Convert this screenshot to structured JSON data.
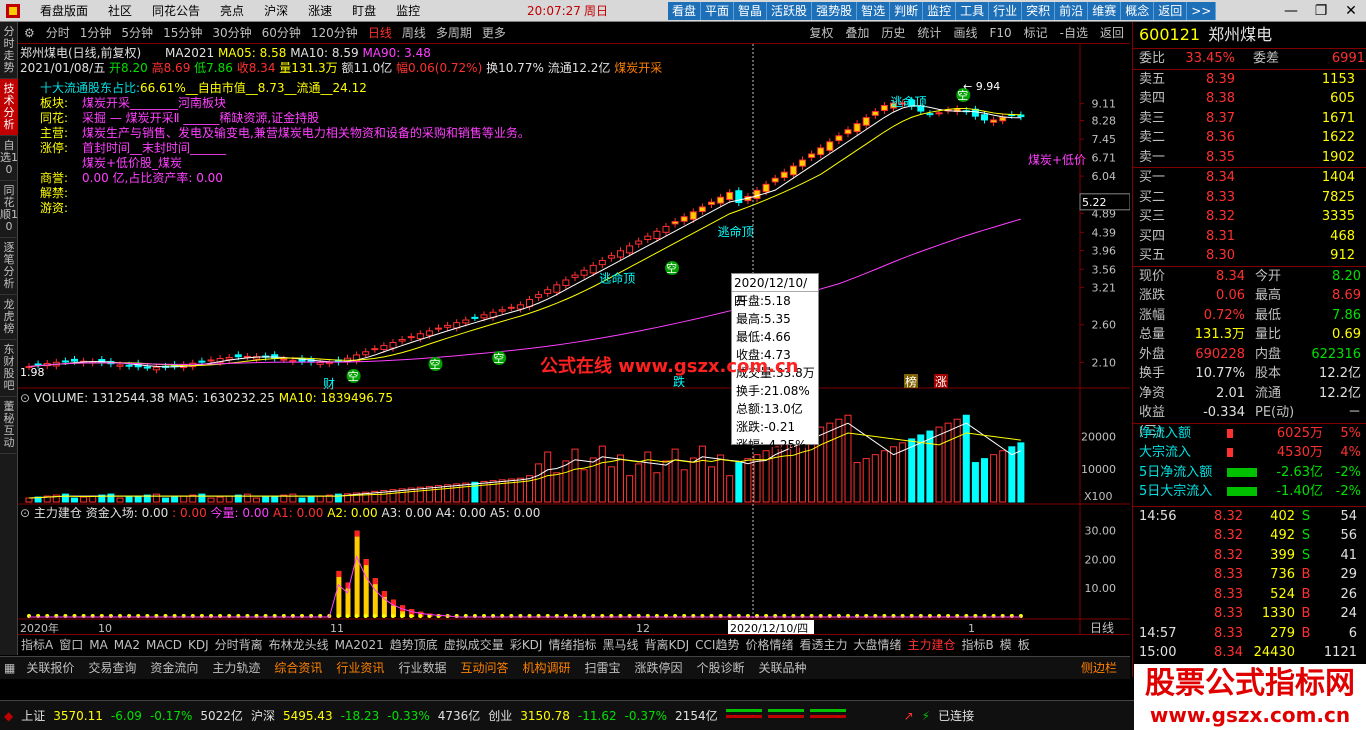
{
  "menu": {
    "items": [
      "看盘版面",
      "社区",
      "同花公告",
      "亮点",
      "沪深",
      "涨速",
      "盯盘",
      "监控"
    ],
    "time": "20:07:27",
    "weekday": "周日",
    "quick": [
      "看盘",
      "平面",
      "智晶",
      "活跃股",
      "强势股",
      "智选",
      "判断",
      "监控",
      "工具",
      "行业",
      "突积",
      "前沿",
      "维赛",
      "概念",
      "返回",
      ">>"
    ]
  },
  "vtabs": [
    "分时走势",
    "技术分析",
    "自选10",
    "同花顺10",
    "逐笔分析",
    "龙虎榜",
    "东财股吧",
    "董秘互动"
  ],
  "periods": [
    "分时",
    "1分钟",
    "5分钟",
    "15分钟",
    "30分钟",
    "60分钟",
    "120分钟",
    "日线",
    "周线",
    "多周期",
    "更多"
  ],
  "period_active": "日线",
  "toolbar": [
    "复权",
    "叠加",
    "历史",
    "统计",
    "画线",
    "F10",
    "标记",
    "-自选",
    "返回"
  ],
  "chart": {
    "title": "郑州煤电(日线,前复权)",
    "ma_label": "MA2021",
    "ma05": "MA05: 8.58",
    "ma10": "MA10: 8.59",
    "ma90": "MA90: 3.48",
    "date": "2021/01/08/五",
    "open": "开8.20",
    "high": "高8.69",
    "low": "低7.86",
    "close": "收8.34",
    "vol": "量131.3万",
    "amt": "额11.0亿",
    "chg": "幅0.06(0.72%)",
    "turn": "换10.77%",
    "float": "流通12.2亿",
    "concept": "煤炭开采",
    "info_lines": [
      {
        "label": "十大流通股东占比:",
        "value": "66.61%__自由市值__8.73__流通__24.12"
      },
      {
        "label": "板块:",
        "value": "煤炭开采________河南板块"
      },
      {
        "label": "同花:",
        "value": "采掘 — 煤炭开采Ⅱ ______稀缺资源,证金持股"
      },
      {
        "label": "主营:",
        "value": "煤炭生产与销售、发电及输变电,兼营煤炭电力相关物资和设备的采购和销售等业务。"
      },
      {
        "label": "涨停:",
        "value": "首封时间__末封时间______"
      },
      {
        "label": "",
        "value": "煤炭+低价股_煤炭"
      },
      {
        "label": "商誉:",
        "value": "0.00 亿,占比资产率: 0.00"
      },
      {
        "label": "解禁:",
        "value": ""
      },
      {
        "label": "游资:",
        "value": ""
      }
    ],
    "y_ticks": [
      "9.11",
      "8.28",
      "7.45",
      "6.71",
      "6.04",
      "4.89",
      "4.39",
      "3.96",
      "3.56",
      "3.21",
      "2.60",
      "2.10"
    ],
    "cursor_price": "5.22",
    "peak_label": "9.94",
    "low_label": "1.98",
    "labels": {
      "escape": "逃命顶",
      "air": "空",
      "wealth": "财",
      "fall": "跌",
      "rank": "榜",
      "rise": "涨",
      "concept_tag": "煤炭+低价"
    },
    "x_ticks": [
      "2020年",
      "10",
      "11",
      "12",
      "2020/12/10/四",
      "1"
    ],
    "x_right": "日线"
  },
  "volume": {
    "label": "VOLUME: 1312544.38",
    "ma5": "MA5: 1630232.25",
    "ma10": "MA10: 1839496.75",
    "y_ticks": [
      "20000",
      "10000"
    ],
    "unit": "X100"
  },
  "indicator": {
    "label": "主力建仓",
    "v1": "资金入场: 0.00",
    "v2": ": 0.00",
    "v3": "今量: 0.00",
    "a1": "A1: 0.00",
    "a2": "A2: 0.00",
    "a3": "A3: 0.00",
    "a4": "A4: 0.00",
    "a5": "A5: 0.00",
    "y_ticks": [
      "30.00",
      "20.00",
      "10.00"
    ]
  },
  "tooltip": {
    "date": "2020/12/10/四",
    "lines": [
      "开盘:5.18",
      "最高:5.35",
      "最低:4.66",
      "收盘:4.73",
      "成交量:33.8万",
      "换手:21.08%",
      "总额:13.0亿",
      "涨跌:-0.21",
      "涨幅:-4.25%"
    ]
  },
  "watermark": "公式在线 www.gszx.com.cn",
  "indicator_tabs": [
    "指标A",
    "窗口",
    "MA",
    "MA2",
    "MACD",
    "KDJ",
    "分时背离",
    "布林龙头线",
    "MA2021",
    "趋势顶底",
    "虚拟成交量",
    "彩KDJ",
    "情绪指标",
    "黑马线",
    "背离KDJ",
    "CCI趋势",
    "价格情绪",
    "看透主力",
    "大盘情绪",
    "主力建仓",
    "指标B",
    "模",
    "板"
  ],
  "indicator_active": "主力建仓",
  "bottom_tabs": [
    {
      "t": "关联报价",
      "hl": false
    },
    {
      "t": "交易查询",
      "hl": false
    },
    {
      "t": "资金流向",
      "hl": false
    },
    {
      "t": "主力轨迹",
      "hl": false
    },
    {
      "t": "综合资讯",
      "hl": true
    },
    {
      "t": "行业资讯",
      "hl": true
    },
    {
      "t": "行业数据",
      "hl": false
    },
    {
      "t": "互动问答",
      "hl": true
    },
    {
      "t": "机构调研",
      "hl": true
    },
    {
      "t": "扫雷宝",
      "hl": false
    },
    {
      "t": "涨跌停因",
      "hl": false
    },
    {
      "t": "个股诊断",
      "hl": false
    },
    {
      "t": "关联品种",
      "hl": false
    }
  ],
  "side_label": "侧边栏",
  "status": {
    "sh_name": "上证",
    "sh_val": "3570.11",
    "sh_chg": "-6.09",
    "sh_pct": "-0.17%",
    "sh_amt": "5022亿",
    "sz_name": "沪深",
    "sz_val": "5495.43",
    "sz_chg": "-18.23",
    "sz_pct": "-0.33%",
    "sz_amt": "4736亿",
    "cy_name": "创业",
    "cy_val": "3150.78",
    "cy_chg": "-11.62",
    "cy_pct": "-0.37%",
    "cy_amt": "2154亿",
    "conn": "已连接"
  },
  "quote": {
    "code": "600121",
    "name": "郑州煤电",
    "ratio_label": "委比",
    "ratio": "33.45%",
    "diff_label": "委差",
    "diff": "6991",
    "asks": [
      {
        "l": "卖五",
        "p": "8.39",
        "v": "1153"
      },
      {
        "l": "卖四",
        "p": "8.38",
        "v": "605"
      },
      {
        "l": "卖三",
        "p": "8.37",
        "v": "1671"
      },
      {
        "l": "卖二",
        "p": "8.36",
        "v": "1622"
      },
      {
        "l": "卖一",
        "p": "8.35",
        "v": "1902"
      }
    ],
    "bids": [
      {
        "l": "买一",
        "p": "8.34",
        "v": "1404"
      },
      {
        "l": "买二",
        "p": "8.33",
        "v": "7825"
      },
      {
        "l": "买三",
        "p": "8.32",
        "v": "3335"
      },
      {
        "l": "买四",
        "p": "8.31",
        "v": "468"
      },
      {
        "l": "买五",
        "p": "8.30",
        "v": "912"
      }
    ],
    "stats": [
      {
        "l1": "现价",
        "v1": "8.34",
        "c1": "red",
        "l2": "今开",
        "v2": "8.20",
        "c2": "grn"
      },
      {
        "l1": "涨跌",
        "v1": "0.06",
        "c1": "red",
        "l2": "最高",
        "v2": "8.69",
        "c2": "red"
      },
      {
        "l1": "涨幅",
        "v1": "0.72%",
        "c1": "red",
        "l2": "最低",
        "v2": "7.86",
        "c2": "grn"
      },
      {
        "l1": "总量",
        "v1": "131.3万",
        "c1": "yel",
        "l2": "量比",
        "v2": "0.69",
        "c2": "yel"
      },
      {
        "l1": "外盘",
        "v1": "690228",
        "c1": "red",
        "l2": "内盘",
        "v2": "622316",
        "c2": "grn"
      },
      {
        "l1": "换手",
        "v1": "10.77%",
        "c1": "wht",
        "l2": "股本",
        "v2": "12.2亿",
        "c2": "wht"
      },
      {
        "l1": "净资",
        "v1": "2.01",
        "c1": "wht",
        "l2": "流通",
        "v2": "12.2亿",
        "c2": "wht"
      },
      {
        "l1": "收益(三)",
        "v1": "-0.334",
        "c1": "wht",
        "l2": "PE(动)",
        "v2": "－",
        "c2": "wht"
      }
    ],
    "flows": [
      {
        "l": "净流入额",
        "v": "6025万",
        "p": "5%",
        "c": "red"
      },
      {
        "l": "大宗流入",
        "v": "4530万",
        "p": "4%",
        "c": "red"
      },
      {
        "l": "5日净流入额",
        "v": "-2.63亿",
        "p": "-2%",
        "c": "grn"
      },
      {
        "l": "5日大宗流入",
        "v": "-1.40亿",
        "p": "-2%",
        "c": "grn"
      }
    ],
    "ticks": [
      {
        "t": "14:56",
        "p": "8.32",
        "v": "402",
        "s": "S",
        "n": "54"
      },
      {
        "t": "",
        "p": "8.32",
        "v": "492",
        "s": "S",
        "n": "56"
      },
      {
        "t": "",
        "p": "8.32",
        "v": "399",
        "s": "S",
        "n": "41"
      },
      {
        "t": "",
        "p": "8.33",
        "v": "736",
        "s": "B",
        "n": "29"
      },
      {
        "t": "",
        "p": "8.33",
        "v": "524",
        "s": "B",
        "n": "26"
      },
      {
        "t": "",
        "p": "8.33",
        "v": "1330",
        "s": "B",
        "n": "24"
      },
      {
        "t": "14:57",
        "p": "8.33",
        "v": "279",
        "s": "B",
        "n": "6"
      },
      {
        "t": "15:00",
        "p": "8.34",
        "v": "24430",
        "s": "",
        "n": "1121"
      }
    ]
  },
  "brand": {
    "line1": "股票公式指标网",
    "line2": "www.gszx.com.cn"
  }
}
